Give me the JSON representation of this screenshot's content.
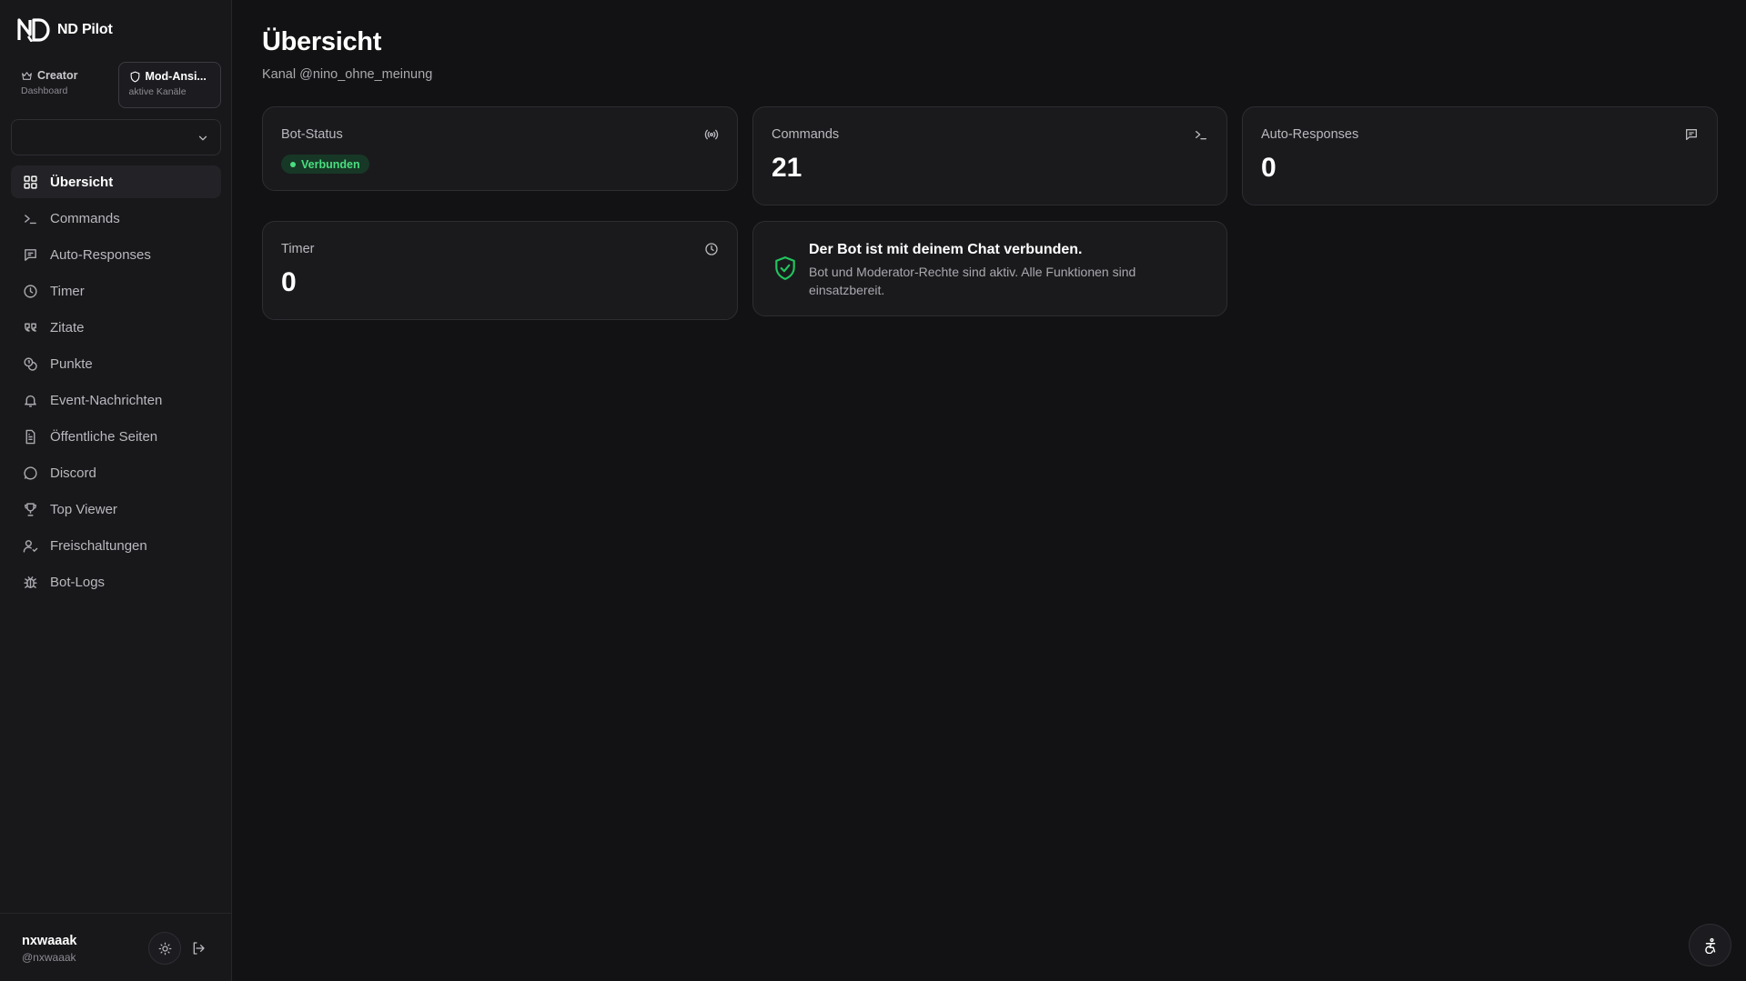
{
  "app": {
    "name": "ND Pilot"
  },
  "modes": [
    {
      "label": "Creator",
      "sublabel": "Dashboard",
      "icon": "crown-icon"
    },
    {
      "label": "Mod-Ansi...",
      "sublabel": "aktive Kanäle",
      "icon": "shield-icon"
    }
  ],
  "channel_select": {
    "value": ""
  },
  "nav": {
    "items": [
      {
        "label": "Übersicht",
        "icon": "dashboard-grid-icon",
        "active": true
      },
      {
        "label": "Commands",
        "icon": "terminal-icon"
      },
      {
        "label": "Auto-Responses",
        "icon": "message-square-icon"
      },
      {
        "label": "Timer",
        "icon": "clock-icon"
      },
      {
        "label": "Zitate",
        "icon": "quote-icon"
      },
      {
        "label": "Punkte",
        "icon": "coins-icon"
      },
      {
        "label": "Event-Nachrichten",
        "icon": "bell-icon"
      },
      {
        "label": "Öffentliche Seiten",
        "icon": "file-text-icon"
      },
      {
        "label": "Discord",
        "icon": "chat-bubble-icon"
      },
      {
        "label": "Top Viewer",
        "icon": "trophy-icon"
      },
      {
        "label": "Freischaltungen",
        "icon": "user-check-icon"
      },
      {
        "label": "Bot-Logs",
        "icon": "bug-icon"
      }
    ]
  },
  "user": {
    "name": "nxwaaak",
    "handle": "@nxwaaak"
  },
  "page": {
    "title": "Übersicht",
    "subtitle": "Kanal @nino_ohne_meinung"
  },
  "cards": {
    "bot_status": {
      "label": "Bot-Status",
      "badge": "Verbunden",
      "icon": "broadcast-icon",
      "status_color": "#4ade80"
    },
    "commands": {
      "label": "Commands",
      "value": "21",
      "icon": "terminal-icon"
    },
    "auto_responses": {
      "label": "Auto-Responses",
      "value": "0",
      "icon": "message-square-icon"
    },
    "timer": {
      "label": "Timer",
      "value": "0",
      "icon": "clock-icon"
    }
  },
  "info": {
    "title": "Der Bot ist mit deinem Chat verbunden.",
    "text": "Bot und Moderator-Rechte sind aktiv. Alle Funktionen sind einsatzbereit.",
    "icon": "shield-check-icon",
    "accent": "#22c55e"
  },
  "colors": {
    "background": "#121214",
    "sidebar": "#18181b",
    "card": "#1a1a1d",
    "success": "#4ade80"
  }
}
